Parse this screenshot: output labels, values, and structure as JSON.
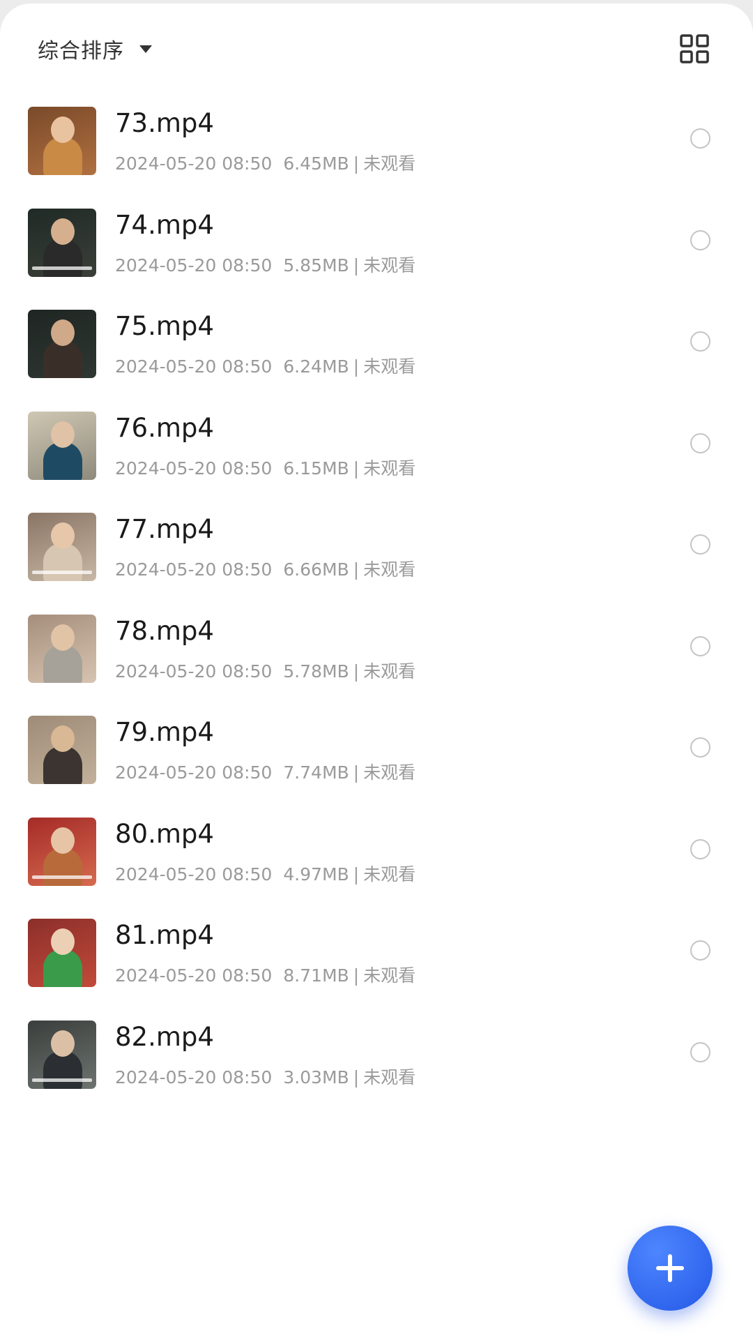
{
  "header": {
    "sort_label": "综合排序",
    "sort_icon": "chevron-down-icon",
    "view_toggle_icon": "grid-view-icon"
  },
  "videos": [
    {
      "title": "73.mp4",
      "date": "2024-05-20 08:50",
      "size": "6.45MB",
      "sep": "|",
      "status": "未观看",
      "selected": false
    },
    {
      "title": "74.mp4",
      "date": "2024-05-20 08:50",
      "size": "5.85MB",
      "sep": "|",
      "status": "未观看",
      "selected": false
    },
    {
      "title": "75.mp4",
      "date": "2024-05-20 08:50",
      "size": "6.24MB",
      "sep": "|",
      "status": "未观看",
      "selected": false
    },
    {
      "title": "76.mp4",
      "date": "2024-05-20 08:50",
      "size": "6.15MB",
      "sep": "|",
      "status": "未观看",
      "selected": false
    },
    {
      "title": "77.mp4",
      "date": "2024-05-20 08:50",
      "size": "6.66MB",
      "sep": "|",
      "status": "未观看",
      "selected": false
    },
    {
      "title": "78.mp4",
      "date": "2024-05-20 08:50",
      "size": "5.78MB",
      "sep": "|",
      "status": "未观看",
      "selected": false
    },
    {
      "title": "79.mp4",
      "date": "2024-05-20 08:50",
      "size": "7.74MB",
      "sep": "|",
      "status": "未观看",
      "selected": false
    },
    {
      "title": "80.mp4",
      "date": "2024-05-20 08:50",
      "size": "4.97MB",
      "sep": "|",
      "status": "未观看",
      "selected": false
    },
    {
      "title": "81.mp4",
      "date": "2024-05-20 08:50",
      "size": "8.71MB",
      "sep": "|",
      "status": "未观看",
      "selected": false
    },
    {
      "title": "82.mp4",
      "date": "2024-05-20 08:50",
      "size": "3.03MB",
      "sep": "|",
      "status": "未观看",
      "selected": false
    }
  ],
  "fab": {
    "icon": "plus-icon",
    "color": "#2f63f0"
  },
  "colors": {
    "title_text": "#1a1a1a",
    "meta_text": "#9a9a9a",
    "radio_border": "#c4c4c4",
    "accent": "#2f63f0"
  }
}
